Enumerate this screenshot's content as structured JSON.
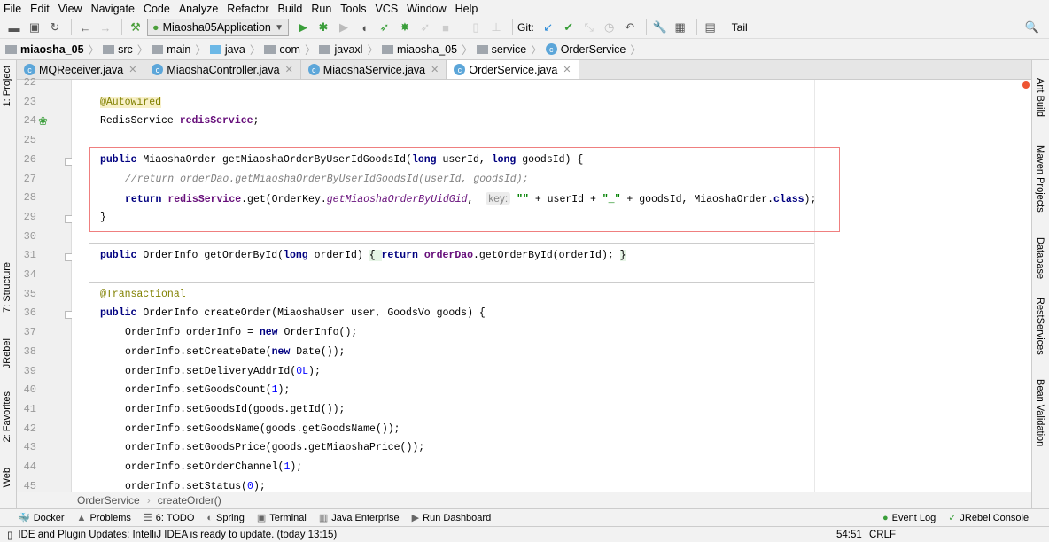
{
  "menu": [
    "File",
    "Edit",
    "View",
    "Navigate",
    "Code",
    "Analyze",
    "Refactor",
    "Build",
    "Run",
    "Tools",
    "VCS",
    "Window",
    "Help"
  ],
  "toolbar": {
    "run_config": "Miaosha05Application",
    "git_label": "Git:",
    "tail_label": "Tail"
  },
  "breadcrumb": [
    "miaosha_05",
    "src",
    "main",
    "java",
    "com",
    "javaxl",
    "miaosha_05",
    "service",
    "OrderService"
  ],
  "tabs": [
    {
      "label": "MQReceiver.java"
    },
    {
      "label": "MiaoshaController.java"
    },
    {
      "label": "MiaoshaService.java"
    },
    {
      "label": "OrderService.java",
      "active": true
    }
  ],
  "left_stripe": [
    "1: Project",
    "7: Structure",
    "JRebel",
    "2: Favorites",
    "Web"
  ],
  "right_stripe": [
    "Ant Build",
    "Maven Projects",
    "Database",
    "RestServices",
    "Bean Validation"
  ],
  "code_lines": [
    {
      "n": "22",
      "indent": 0,
      "tokens": []
    },
    {
      "n": "23",
      "indent": 0,
      "tokens": [
        {
          "t": "@Autowired",
          "c": "ann hl"
        }
      ]
    },
    {
      "n": "24",
      "indent": 0,
      "tokens": [
        {
          "t": "RedisService ",
          "c": ""
        },
        {
          "t": "redisService",
          "c": "fld"
        },
        {
          "t": ";",
          "c": ""
        }
      ]
    },
    {
      "n": "25",
      "indent": 0,
      "tokens": []
    },
    {
      "n": "26",
      "indent": 0,
      "tokens": [
        {
          "t": "public ",
          "c": "kw"
        },
        {
          "t": "MiaoshaOrder getMiaoshaOrderByUserIdGoodsId(",
          "c": ""
        },
        {
          "t": "long ",
          "c": "kw"
        },
        {
          "t": "userId, ",
          "c": ""
        },
        {
          "t": "long ",
          "c": "kw"
        },
        {
          "t": "goodsId) {",
          "c": ""
        }
      ]
    },
    {
      "n": "27",
      "indent": 1,
      "tokens": [
        {
          "t": "//return orderDao.getMiaoshaOrderByUserIdGoodsId(userId, goodsId);",
          "c": "cm"
        }
      ]
    },
    {
      "n": "28",
      "indent": 1,
      "tokens": [
        {
          "t": "return ",
          "c": "kw"
        },
        {
          "t": "redisService",
          "c": "fld"
        },
        {
          "t": ".get(OrderKey.",
          "c": ""
        },
        {
          "t": "getMiaoshaOrderByUidGid",
          "c": "st"
        },
        {
          "t": ",  ",
          "c": ""
        },
        {
          "t": "key:",
          "c": "hint"
        },
        {
          "t": " ",
          "c": ""
        },
        {
          "t": "\"\"",
          "c": "str"
        },
        {
          "t": " + userId + ",
          "c": ""
        },
        {
          "t": "\"_\"",
          "c": "str"
        },
        {
          "t": " + goodsId, MiaoshaOrder.",
          "c": ""
        },
        {
          "t": "class",
          "c": "kw"
        },
        {
          "t": ");",
          "c": ""
        }
      ]
    },
    {
      "n": "29",
      "indent": 0,
      "tokens": [
        {
          "t": "}",
          "c": ""
        }
      ]
    },
    {
      "n": "30",
      "indent": 0,
      "tokens": []
    },
    {
      "n": "31",
      "indent": 0,
      "tokens": [
        {
          "t": "public ",
          "c": "kw"
        },
        {
          "t": "OrderInfo getOrderById(",
          "c": ""
        },
        {
          "t": "long ",
          "c": "kw"
        },
        {
          "t": "orderId) ",
          "c": ""
        },
        {
          "t": "{ ",
          "c": "brace"
        },
        {
          "t": "return ",
          "c": "kw"
        },
        {
          "t": "orderDao",
          "c": "fld"
        },
        {
          "t": ".getOrderById(orderId); ",
          "c": ""
        },
        {
          "t": "}",
          "c": "brace"
        }
      ]
    },
    {
      "n": "34",
      "indent": 0,
      "tokens": []
    },
    {
      "n": "35",
      "indent": 0,
      "tokens": [
        {
          "t": "@Transactional",
          "c": "ann"
        }
      ]
    },
    {
      "n": "36",
      "indent": 0,
      "tokens": [
        {
          "t": "public ",
          "c": "kw"
        },
        {
          "t": "OrderInfo createOrder(MiaoshaUser user, GoodsVo goods) {",
          "c": ""
        }
      ]
    },
    {
      "n": "37",
      "indent": 1,
      "tokens": [
        {
          "t": "OrderInfo orderInfo = ",
          "c": ""
        },
        {
          "t": "new ",
          "c": "kw"
        },
        {
          "t": "OrderInfo();",
          "c": ""
        }
      ]
    },
    {
      "n": "38",
      "indent": 1,
      "tokens": [
        {
          "t": "orderInfo.setCreateDate(",
          "c": ""
        },
        {
          "t": "new ",
          "c": "kw"
        },
        {
          "t": "Date());",
          "c": ""
        }
      ]
    },
    {
      "n": "39",
      "indent": 1,
      "tokens": [
        {
          "t": "orderInfo.setDeliveryAddrId(",
          "c": ""
        },
        {
          "t": "0L",
          "c": "num"
        },
        {
          "t": ");",
          "c": ""
        }
      ]
    },
    {
      "n": "40",
      "indent": 1,
      "tokens": [
        {
          "t": "orderInfo.setGoodsCount(",
          "c": ""
        },
        {
          "t": "1",
          "c": "num"
        },
        {
          "t": ");",
          "c": ""
        }
      ]
    },
    {
      "n": "41",
      "indent": 1,
      "tokens": [
        {
          "t": "orderInfo.setGoodsId(goods.getId());",
          "c": ""
        }
      ]
    },
    {
      "n": "42",
      "indent": 1,
      "tokens": [
        {
          "t": "orderInfo.setGoodsName(goods.getGoodsName());",
          "c": ""
        }
      ]
    },
    {
      "n": "43",
      "indent": 1,
      "tokens": [
        {
          "t": "orderInfo.setGoodsPrice(goods.getMiaoshaPrice());",
          "c": ""
        }
      ]
    },
    {
      "n": "44",
      "indent": 1,
      "tokens": [
        {
          "t": "orderInfo.setOrderChannel(",
          "c": ""
        },
        {
          "t": "1",
          "c": "num"
        },
        {
          "t": ");",
          "c": ""
        }
      ]
    },
    {
      "n": "45",
      "indent": 1,
      "tokens": [
        {
          "t": "orderInfo.setStatus(",
          "c": ""
        },
        {
          "t": "0",
          "c": "num"
        },
        {
          "t": ");",
          "c": ""
        }
      ]
    }
  ],
  "editor_breadcrumb": [
    "OrderService",
    "createOrder()"
  ],
  "tool_windows": [
    {
      "icon": "docker-icon",
      "label": "Docker"
    },
    {
      "icon": "warning-icon",
      "label": "Problems"
    },
    {
      "icon": "list-icon",
      "label": "6: TODO"
    },
    {
      "icon": "spring-icon",
      "label": "Spring"
    },
    {
      "icon": "terminal-icon",
      "label": "Terminal"
    },
    {
      "icon": "java-enterprise-icon",
      "label": "Java Enterprise"
    },
    {
      "icon": "run-icon",
      "label": "Run Dashboard"
    }
  ],
  "tool_windows_right": [
    {
      "icon": "event-log-icon",
      "label": "Event Log"
    },
    {
      "icon": "jrebel-icon",
      "label": "JRebel Console"
    }
  ],
  "status": {
    "message": "IDE and Plugin Updates: IntelliJ IDEA is ready to update. (today 13:15)",
    "position": "54:51",
    "line_sep": "CRLF"
  },
  "colors": {
    "keyword": "#000080",
    "field": "#660e7a",
    "annotation": "#808000",
    "string": "#008000",
    "number": "#0000ff",
    "highlight_box": "#ef7f7f"
  }
}
